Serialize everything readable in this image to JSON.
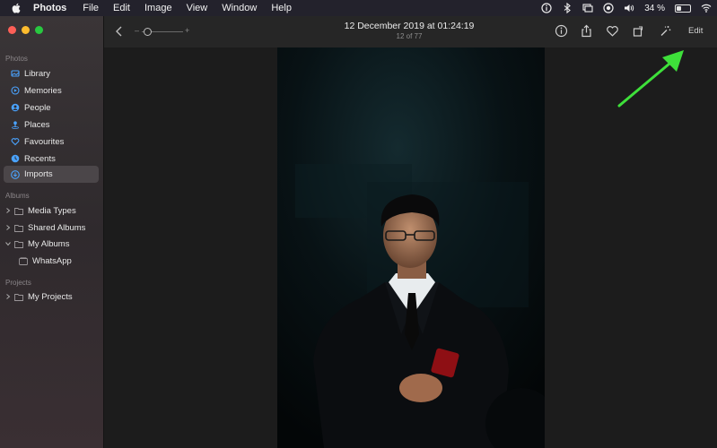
{
  "menubar": {
    "app_name": "Photos",
    "items": [
      "File",
      "Edit",
      "Image",
      "View",
      "Window",
      "Help"
    ],
    "battery_percent": "34 %",
    "battery_level": 0.34
  },
  "window": {
    "traffic_lights": [
      "close",
      "minimize",
      "zoom"
    ]
  },
  "sidebar": {
    "photos_section": "Photos",
    "photos_items": [
      {
        "label": "Library",
        "icon": "library-icon"
      },
      {
        "label": "Memories",
        "icon": "memories-icon"
      },
      {
        "label": "People",
        "icon": "people-icon"
      },
      {
        "label": "Places",
        "icon": "places-icon"
      },
      {
        "label": "Favourites",
        "icon": "heart-icon"
      },
      {
        "label": "Recents",
        "icon": "clock-icon"
      },
      {
        "label": "Imports",
        "icon": "imports-icon",
        "selected": true
      }
    ],
    "albums_section": "Albums",
    "albums_items": [
      {
        "label": "Media Types",
        "icon": "folder-icon",
        "expanded": false
      },
      {
        "label": "Shared Albums",
        "icon": "folder-icon",
        "expanded": false
      },
      {
        "label": "My Albums",
        "icon": "folder-icon",
        "expanded": true
      },
      {
        "label": "WhatsApp",
        "icon": "album-icon"
      }
    ],
    "projects_section": "Projects",
    "projects_items": [
      {
        "label": "My Projects",
        "icon": "folder-icon",
        "expanded": false
      }
    ]
  },
  "toolbar": {
    "title": "12 December 2019 at 01:24:19",
    "subtitle": "12 of 77",
    "edit_label": "Edit",
    "zoom_level": 0.05,
    "icons": [
      "info-icon",
      "share-icon",
      "heart-icon",
      "rotate-icon",
      "magic-wand-icon"
    ]
  },
  "colors": {
    "accent_arrow": "#3ee03a",
    "sidebar_selected": "#4b4649",
    "menubar": "#23222c"
  }
}
